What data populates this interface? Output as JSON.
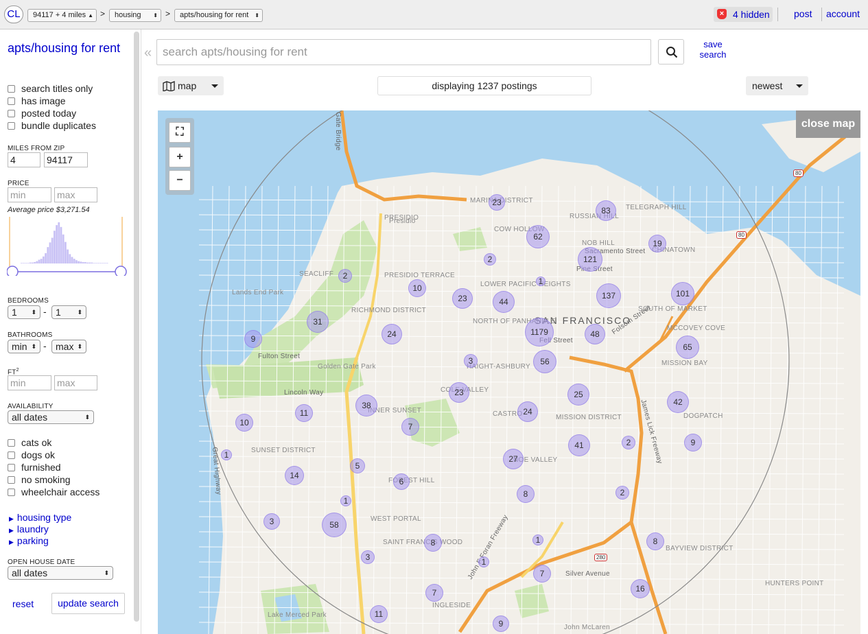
{
  "topbar": {
    "logo": "CL",
    "area_select": "94117 + 4 miles",
    "section_select": "housing",
    "category_select": "apts/housing for rent",
    "sep": ">",
    "hidden": "4 hidden",
    "post": "post",
    "account": "account"
  },
  "sidebar": {
    "title": "apts/housing for rent",
    "checkboxes": [
      "search titles only",
      "has image",
      "posted today",
      "bundle duplicates"
    ],
    "miles_label": "MILES FROM ZIP",
    "miles_value": "4",
    "zip_value": "94117",
    "price_label": "PRICE",
    "min_placeholder": "min",
    "max_placeholder": "max",
    "avg_price": "Average price $3,271.54",
    "bedrooms_label": "BEDROOMS",
    "bedrooms_min": "1",
    "bedrooms_max": "1",
    "bathrooms_label": "BATHROOMS",
    "bath_min": "min",
    "bath_max": "max",
    "dash": "-",
    "ft2_label": "FT",
    "ft2_sup": "2",
    "availability_label": "AVAILABILITY",
    "availability_value": "all dates",
    "checkboxes2": [
      "cats ok",
      "dogs ok",
      "furnished",
      "no smoking",
      "wheelchair access"
    ],
    "more": [
      "housing type",
      "laundry",
      "parking"
    ],
    "openhouse_label": "OPEN HOUSE DATE",
    "openhouse_value": "all dates",
    "reset": "reset",
    "update": "update search",
    "histogram": [
      1,
      1,
      1,
      1,
      2,
      2,
      3,
      5,
      8,
      10,
      15,
      22,
      35,
      45,
      55,
      70,
      82,
      88,
      78,
      62,
      46,
      30,
      20,
      14,
      10,
      7,
      5,
      4,
      3,
      3,
      2,
      2,
      2,
      1,
      1,
      1,
      1,
      1,
      1,
      1
    ]
  },
  "search": {
    "placeholder": "search apts/housing for rent",
    "save": "save search",
    "collapse": "«",
    "mode": "map",
    "count": "displaying 1237 postings",
    "sort": "newest"
  },
  "map": {
    "close": "close map",
    "controls": [
      "fullscreen-icon",
      "+",
      "−"
    ],
    "labels": [
      {
        "t": "SAN FRANCISCO",
        "k": "city"
      },
      {
        "t": "PRESIDIO",
        "k": "n"
      },
      {
        "t": "Presidio",
        "k": "n"
      },
      {
        "t": "MARINA DISTRICT",
        "k": "n"
      },
      {
        "t": "RUSSIAN HILL",
        "k": "n"
      },
      {
        "t": "TELEGRAPH HILL",
        "k": "n"
      },
      {
        "t": "COW HOLLOW",
        "k": "n"
      },
      {
        "t": "Lands End Park",
        "k": "n"
      },
      {
        "t": "SEACLIFF",
        "k": "n"
      },
      {
        "t": "PRESIDIO TERRACE",
        "k": "n"
      },
      {
        "t": "RICHMOND DISTRICT",
        "k": "n"
      },
      {
        "t": "LOWER PACIFIC HEIGHTS",
        "k": "n"
      },
      {
        "t": "NORTH OF PANHANDLE",
        "k": "n"
      },
      {
        "t": "Golden Gate Park",
        "k": "n"
      },
      {
        "t": "Fulton Street",
        "k": "st"
      },
      {
        "t": "Lincoln Way",
        "k": "st"
      },
      {
        "t": "INNER SUNSET",
        "k": "n"
      },
      {
        "t": "SUNSET DISTRICT",
        "k": "n"
      },
      {
        "t": "HAIGHT-ASHBURY",
        "k": "n"
      },
      {
        "t": "CASTRO",
        "k": "n"
      },
      {
        "t": "MISSION DISTRICT",
        "k": "n"
      },
      {
        "t": "SOUTH OF MARKET",
        "k": "n"
      },
      {
        "t": "MCCOVEY COVE",
        "k": "n"
      },
      {
        "t": "MISSION BAY",
        "k": "n"
      },
      {
        "t": "DOGPATCH",
        "k": "n"
      },
      {
        "t": "BAYVIEW DISTRICT",
        "k": "n"
      },
      {
        "t": "HUNTERS POINT",
        "k": "n"
      },
      {
        "t": "WEST PORTAL",
        "k": "n"
      },
      {
        "t": "SAINT FRANCIS WOOD",
        "k": "n"
      },
      {
        "t": "INGLESIDE",
        "k": "n"
      },
      {
        "t": "Lake Merced Park",
        "k": "n"
      },
      {
        "t": "Silver Avenue",
        "k": "st"
      },
      {
        "t": "John McLaren",
        "k": "n"
      },
      {
        "t": "James Lick Freeway",
        "k": "st"
      },
      {
        "t": "John F Foran Freeway",
        "k": "st"
      },
      {
        "t": "Folsom Street",
        "k": "st"
      },
      {
        "t": "Pine Street",
        "k": "st"
      },
      {
        "t": "Sacramento Street",
        "k": "st"
      },
      {
        "t": "Fell Street",
        "k": "st"
      },
      {
        "t": "Great Highway",
        "k": "st"
      },
      {
        "t": "Gate Bridge",
        "k": "st"
      },
      {
        "t": "NOB HILL",
        "k": "n"
      },
      {
        "t": "COLE VALLEY",
        "k": "n"
      },
      {
        "t": "NOE VALLEY",
        "k": "n"
      },
      {
        "t": "FOREST HILL",
        "k": "n"
      },
      {
        "t": "CHINATOWN",
        "k": "n"
      }
    ],
    "clusters": [
      {
        "n": "23",
        "s": 24
      },
      {
        "n": "83",
        "s": 30
      },
      {
        "n": "62",
        "s": 34
      },
      {
        "n": "19",
        "s": 26
      },
      {
        "n": "121",
        "s": 36
      },
      {
        "n": "2",
        "s": 18
      },
      {
        "n": "1",
        "s": 14
      },
      {
        "n": "137",
        "s": 36
      },
      {
        "n": "101",
        "s": 34
      },
      {
        "n": "10",
        "s": 26
      },
      {
        "n": "23",
        "s": 30
      },
      {
        "n": "44",
        "s": 32
      },
      {
        "n": "2",
        "s": 20
      },
      {
        "n": "31",
        "s": 32
      },
      {
        "n": "1179",
        "s": 42
      },
      {
        "n": "48",
        "s": 30
      },
      {
        "n": "9",
        "s": 26
      },
      {
        "n": "24",
        "s": 30
      },
      {
        "n": "65",
        "s": 34
      },
      {
        "n": "3",
        "s": 20
      },
      {
        "n": "56",
        "s": 34
      },
      {
        "n": "23",
        "s": 30
      },
      {
        "n": "25",
        "s": 32
      },
      {
        "n": "42",
        "s": 32
      },
      {
        "n": "38",
        "s": 32
      },
      {
        "n": "11",
        "s": 26
      },
      {
        "n": "10",
        "s": 26
      },
      {
        "n": "24",
        "s": 30
      },
      {
        "n": "7",
        "s": 26
      },
      {
        "n": "2",
        "s": 20
      },
      {
        "n": "9",
        "s": 26
      },
      {
        "n": "41",
        "s": 32
      },
      {
        "n": "1",
        "s": 16
      },
      {
        "n": "5",
        "s": 22
      },
      {
        "n": "14",
        "s": 28
      },
      {
        "n": "27",
        "s": 30
      },
      {
        "n": "6",
        "s": 24
      },
      {
        "n": "8",
        "s": 26
      },
      {
        "n": "2",
        "s": 20
      },
      {
        "n": "1",
        "s": 16
      },
      {
        "n": "3",
        "s": 24
      },
      {
        "n": "58",
        "s": 36
      },
      {
        "n": "8",
        "s": 26
      },
      {
        "n": "1",
        "s": 16
      },
      {
        "n": "8",
        "s": 26
      },
      {
        "n": "3",
        "s": 20
      },
      {
        "n": "1",
        "s": 16
      },
      {
        "n": "7",
        "s": 26
      },
      {
        "n": "16",
        "s": 28
      },
      {
        "n": "7",
        "s": 26
      },
      {
        "n": "11",
        "s": 26
      },
      {
        "n": "9",
        "s": 24
      }
    ],
    "highways": [
      "80",
      "280"
    ]
  }
}
